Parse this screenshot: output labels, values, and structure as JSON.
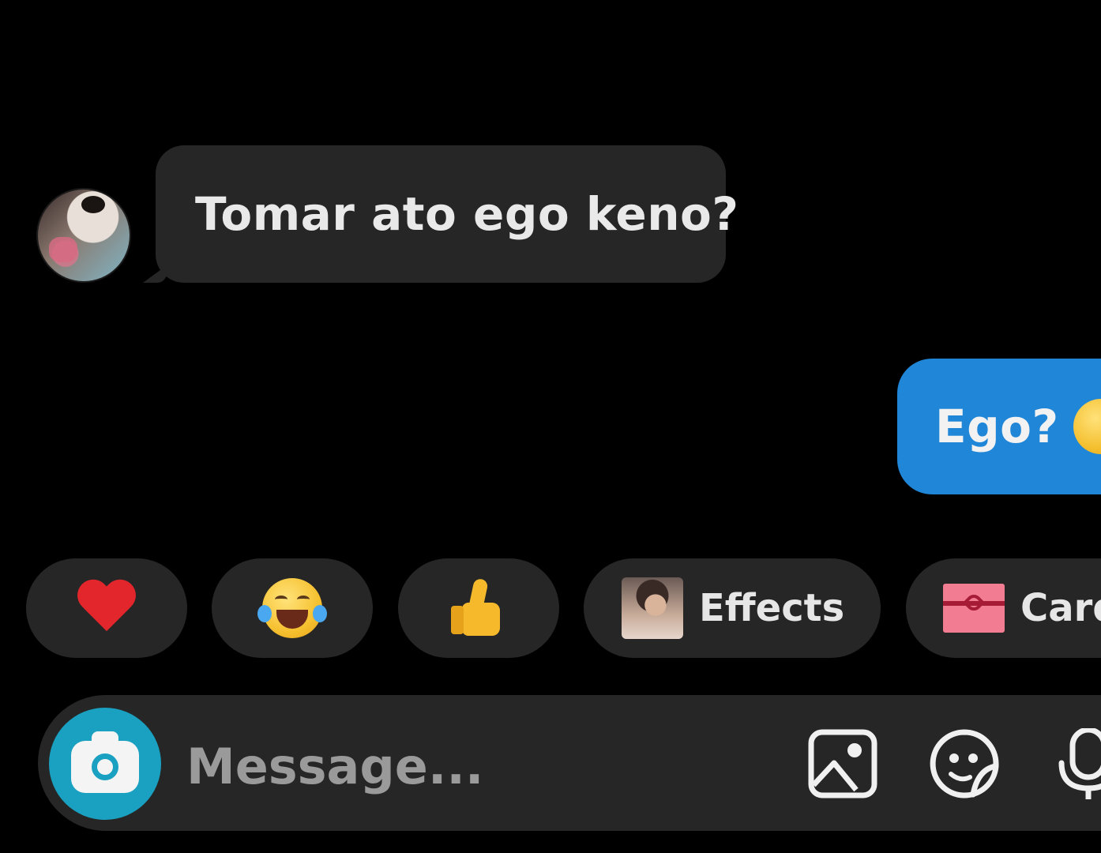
{
  "thread": {
    "incoming": {
      "text": "Tomar ato ego keno?",
      "avatar_icon": "contact-avatar"
    },
    "outgoing": {
      "text": "Ego?",
      "emoji": "relieved-face-emoji"
    }
  },
  "quick_reactions": [
    {
      "icon": "red-heart-emoji"
    },
    {
      "icon": "face-with-tears-of-joy-emoji"
    },
    {
      "icon": "thumbs-up-emoji"
    },
    {
      "label": "Effects",
      "icon": "effects-thumbnail"
    },
    {
      "label": "Card",
      "icon": "gift-card-icon"
    }
  ],
  "composer": {
    "placeholder": "Message...",
    "camera_icon": "camera-icon",
    "gallery_icon": "gallery-icon",
    "sticker_icon": "sticker-icon",
    "mic_icon": "microphone-icon"
  },
  "colors": {
    "background": "#000000",
    "bubble_incoming": "#262626",
    "bubble_outgoing": "#1f86d8",
    "camera_button": "#1aa0c0"
  }
}
